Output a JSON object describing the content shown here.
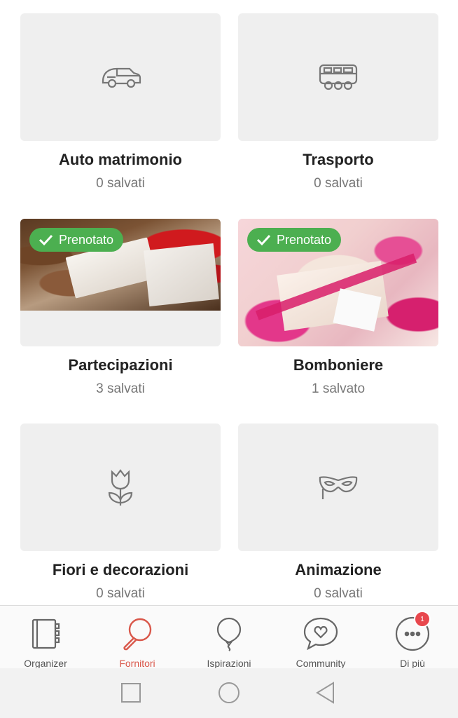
{
  "categories": [
    {
      "title": "Auto matrimonio",
      "count": "0 salvati",
      "icon": "car-icon",
      "booked": false
    },
    {
      "title": "Trasporto",
      "count": "0 salvati",
      "icon": "bus-icon",
      "booked": false
    },
    {
      "title": "Partecipazioni",
      "count": "3 salvati",
      "icon": "invitations-photo",
      "booked": true,
      "badge": "Prenotato"
    },
    {
      "title": "Bomboniere",
      "count": "1 salvato",
      "icon": "favors-photo",
      "booked": true,
      "badge": "Prenotato"
    },
    {
      "title": "Fiori e decorazioni",
      "count": "0 salvati",
      "icon": "tulip-icon",
      "booked": false
    },
    {
      "title": "Animazione",
      "count": "0 salvati",
      "icon": "mask-icon",
      "booked": false
    }
  ],
  "tabbar": {
    "items": [
      {
        "label": "Organizer",
        "icon": "notebook-icon",
        "active": false
      },
      {
        "label": "Fornitori",
        "icon": "magnifier-icon",
        "active": true
      },
      {
        "label": "Ispirazioni",
        "icon": "balloon-icon",
        "active": false
      },
      {
        "label": "Community",
        "icon": "chat-heart-icon",
        "active": false
      },
      {
        "label": "Di più",
        "icon": "more-icon",
        "active": false,
        "notification": "1"
      }
    ]
  },
  "colors": {
    "accent": "#d9574a",
    "badge": "#4caf50",
    "notification": "#e8474d"
  }
}
